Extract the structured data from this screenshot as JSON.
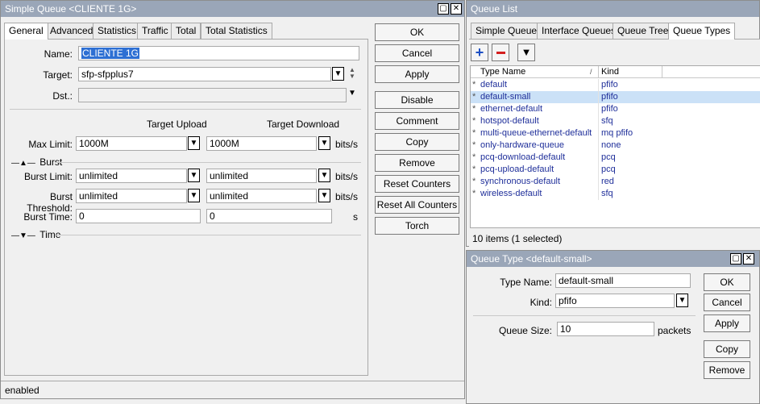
{
  "simple_queue": {
    "title": "Simple Queue <CLIENTE 1G>",
    "tabs": [
      "General",
      "Advanced",
      "Statistics",
      "Traffic",
      "Total",
      "Total Statistics"
    ],
    "name_label": "Name:",
    "name_value": "CLIENTE 1G",
    "target_label": "Target:",
    "target_value": "sfp-sfpplus7",
    "dst_label": "Dst.:",
    "dst_value": "",
    "col_upload": "Target Upload",
    "col_download": "Target Download",
    "max_limit_label": "Max Limit:",
    "max_limit_up": "1000M",
    "max_limit_down": "1000M",
    "unit_bits": "bits/s",
    "burst_section": "Burst",
    "burst_limit_label": "Burst Limit:",
    "burst_limit_up": "unlimited",
    "burst_limit_down": "unlimited",
    "burst_threshold_label": "Burst Threshold:",
    "burst_threshold_up": "unlimited",
    "burst_threshold_down": "unlimited",
    "burst_time_label": "Burst Time:",
    "burst_time_up": "0",
    "burst_time_down": "0",
    "unit_s": "s",
    "time_section": "Time",
    "status": "enabled",
    "buttons": {
      "ok": "OK",
      "cancel": "Cancel",
      "apply": "Apply",
      "disable": "Disable",
      "comment": "Comment",
      "copy": "Copy",
      "remove": "Remove",
      "reset_counters": "Reset Counters",
      "reset_all_counters": "Reset All Counters",
      "torch": "Torch"
    }
  },
  "queue_list": {
    "title": "Queue List",
    "tabs": [
      "Simple Queues",
      "Interface Queues",
      "Queue Tree",
      "Queue Types"
    ],
    "columns": {
      "type_name": "Type Name",
      "kind": "Kind"
    },
    "rows": [
      {
        "mark": "*",
        "name": "default",
        "kind": "pfifo"
      },
      {
        "mark": "*",
        "name": "default-small",
        "kind": "pfifo"
      },
      {
        "mark": "*",
        "name": "ethernet-default",
        "kind": "pfifo"
      },
      {
        "mark": "*",
        "name": "hotspot-default",
        "kind": "sfq"
      },
      {
        "mark": "*",
        "name": "multi-queue-ethernet-default",
        "kind": "mq pfifo"
      },
      {
        "mark": "*",
        "name": "only-hardware-queue",
        "kind": "none"
      },
      {
        "mark": "*",
        "name": "pcq-download-default",
        "kind": "pcq"
      },
      {
        "mark": "*",
        "name": "pcq-upload-default",
        "kind": "pcq"
      },
      {
        "mark": "*",
        "name": "synchronous-default",
        "kind": "red"
      },
      {
        "mark": "*",
        "name": "wireless-default",
        "kind": "sfq"
      }
    ],
    "status": "10 items (1 selected)"
  },
  "queue_type": {
    "title": "Queue Type <default-small>",
    "type_name_label": "Type Name:",
    "type_name_value": "default-small",
    "kind_label": "Kind:",
    "kind_value": "pfifo",
    "queue_size_label": "Queue Size:",
    "queue_size_value": "10",
    "unit_packets": "packets",
    "buttons": {
      "ok": "OK",
      "cancel": "Cancel",
      "apply": "Apply",
      "copy": "Copy",
      "remove": "Remove"
    }
  }
}
